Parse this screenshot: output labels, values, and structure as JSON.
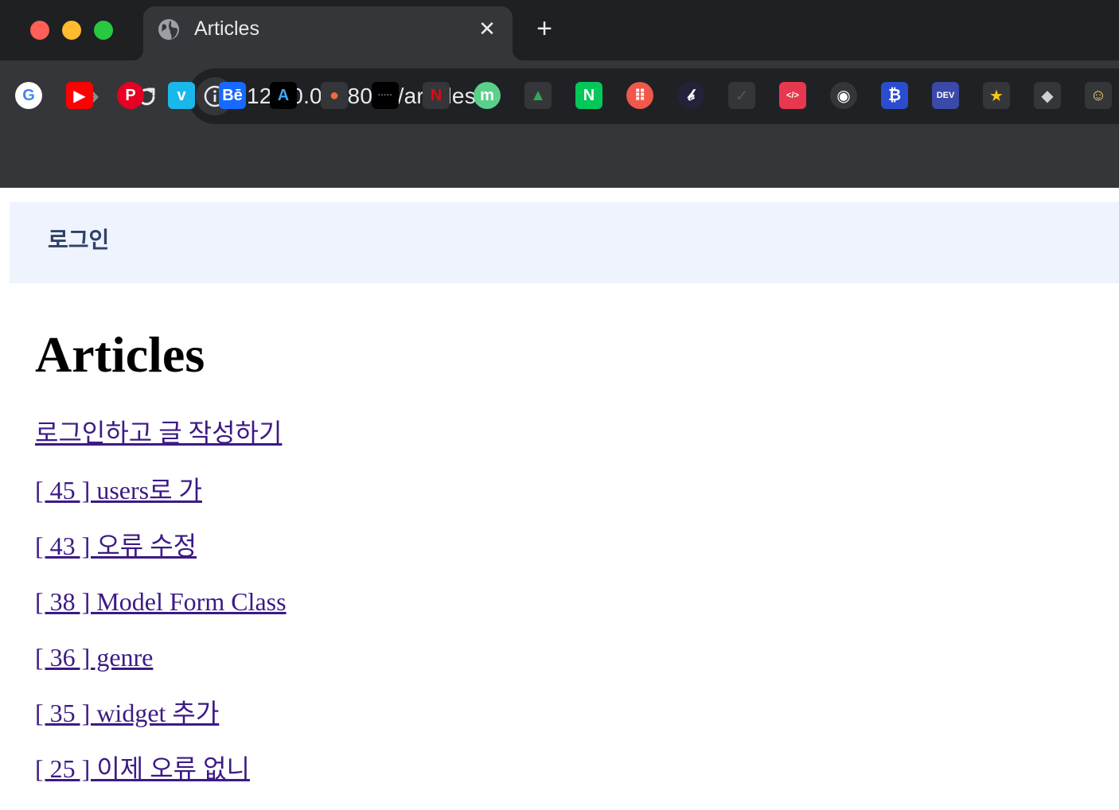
{
  "browser": {
    "tab": {
      "title": "Articles",
      "close_glyph": "✕",
      "favicon": "globe-icon"
    },
    "new_tab_glyph": "+",
    "address_bar": {
      "url": "127.0.0.1:8000/articles/"
    },
    "bookmarks": [
      {
        "name": "google",
        "label": "G",
        "color": "#ffffff",
        "fg": "#4285f4"
      },
      {
        "name": "youtube",
        "label": "▶",
        "color": "#ff0000",
        "fg": "#ffffff"
      },
      {
        "name": "pinterest",
        "label": "P",
        "color": "#e60023",
        "fg": "#ffffff"
      },
      {
        "name": "vimeo",
        "label": "v",
        "color": "#1ab7ea",
        "fg": "#ffffff"
      },
      {
        "name": "behance",
        "label": "Bē",
        "color": "#1769ff",
        "fg": "#ffffff"
      },
      {
        "name": "font-app",
        "label": "A",
        "color": "#000000",
        "fg": "#3fa9f5"
      },
      {
        "name": "orange-app",
        "label": "●",
        "color": "#35363a",
        "fg": "#f26b38"
      },
      {
        "name": "black-app",
        "label": "·····",
        "color": "#000000",
        "fg": "#888888"
      },
      {
        "name": "netflix",
        "label": "N",
        "color": "#35363a",
        "fg": "#e50914"
      },
      {
        "name": "m-app",
        "label": "m",
        "color": "#5ad08a",
        "fg": "#ffffff"
      },
      {
        "name": "google-drive",
        "label": "▲",
        "color": "#35363a",
        "fg": "#34a853"
      },
      {
        "name": "naver",
        "label": "N",
        "color": "#03c75a",
        "fg": "#ffffff"
      },
      {
        "name": "red-dots-app",
        "label": "⠿",
        "color": "#f0584a",
        "fg": "#ffffff"
      },
      {
        "name": "pen-app",
        "label": "𝒷",
        "color": "#22223a",
        "fg": "#ffffff"
      },
      {
        "name": "check-app",
        "label": "✓",
        "color": "#35363a",
        "fg": "#555555"
      },
      {
        "name": "code-heart-app",
        "label": "</>",
        "color": "#e8384f",
        "fg": "#ffffff"
      },
      {
        "name": "github",
        "label": "◉",
        "color": "#35363a",
        "fg": "#ffffff"
      },
      {
        "name": "blue-app",
        "label": "₿",
        "color": "#2a4dd0",
        "fg": "#ffffff"
      },
      {
        "name": "dev-to",
        "label": "DEV",
        "color": "#3b49a9",
        "fg": "#ffffff"
      },
      {
        "name": "star",
        "label": "★",
        "color": "#35363a",
        "fg": "#f5c518"
      },
      {
        "name": "tag-app",
        "label": "◆",
        "color": "#35363a",
        "fg": "#d0d0d0"
      },
      {
        "name": "avatar-app",
        "label": "☺",
        "color": "#35363a",
        "fg": "#f5d76e"
      }
    ]
  },
  "header": {
    "login_label": "로그인"
  },
  "main": {
    "title": "Articles",
    "write_link": "로그인하고 글 작성하기",
    "articles": [
      "[ 45 ] users로 가",
      "[ 43 ] 오류 수정",
      "[ 38 ] Model Form Class",
      "[ 36 ] genre",
      "[ 35 ] widget 추가",
      "[ 25 ] 이제 오류 없니"
    ]
  }
}
